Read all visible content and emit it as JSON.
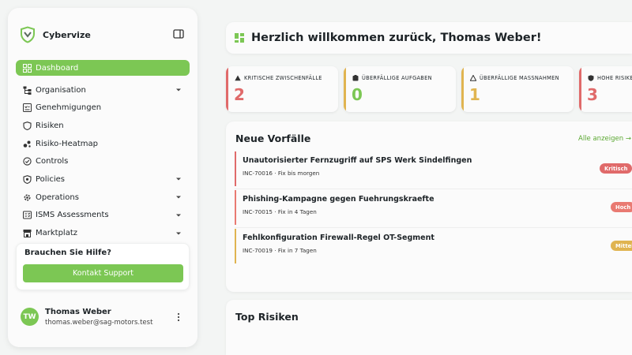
{
  "app": {
    "name": "Cybervize"
  },
  "sidebar": {
    "items": [
      {
        "label": "Dashboard",
        "icon": "grid-icon"
      },
      {
        "label": "Organisation",
        "icon": "org-icon"
      },
      {
        "label": "Genehmigungen",
        "icon": "approvals-icon"
      },
      {
        "label": "Risiken",
        "icon": "shield-icon"
      },
      {
        "label": "Risiko-Heatmap",
        "icon": "heatmap-icon"
      },
      {
        "label": "Controls",
        "icon": "controls-icon"
      },
      {
        "label": "Policies",
        "icon": "policy-icon"
      },
      {
        "label": "Operations",
        "icon": "gear-icon"
      },
      {
        "label": "ISMS Assessments",
        "icon": "assessment-icon"
      },
      {
        "label": "Marktplatz",
        "icon": "store-icon"
      }
    ],
    "help": {
      "title": "Brauchen Sie Hilfe?",
      "button": "Kontakt Support"
    },
    "user": {
      "initials": "TW",
      "name": "Thomas Weber",
      "email": "thomas.weber@sag-motors.test"
    }
  },
  "main": {
    "welcome": "Herzlich willkommen zurück, Thomas Weber!",
    "stats": [
      {
        "label": "KRITISCHE ZWISCHENFÄLLE",
        "value": "2",
        "color": "#e06a6a",
        "icon": "warning-icon"
      },
      {
        "label": "ÜBERFÄLLIGE AUFGABEN",
        "value": "0",
        "color": "#7cc754",
        "icon": "task-icon"
      },
      {
        "label": "ÜBERFÄLLIGE MASSNAHMEN",
        "value": "1",
        "color": "#e0b450",
        "icon": "warning-icon"
      },
      {
        "label": "HOHE RISIKEN",
        "value": "3",
        "color": "#e06a6a",
        "icon": "shield-icon"
      }
    ],
    "incidents": {
      "title": "Neue Vorfälle",
      "show_all": "Alle anzeigen →",
      "items": [
        {
          "title": "Unautorisierter Fernzugriff auf SPS Werk Sindelfingen",
          "sub": "INC-70016 · Fix bis morgen",
          "badge": "Kritisch",
          "color": "#e06a6a"
        },
        {
          "title": "Phishing-Kampagne gegen Fuehrungskraefte",
          "sub": "INC-70015 · Fix in 4 Tagen",
          "badge": "Hoch",
          "color": "#e97a72"
        },
        {
          "title": "Fehlkonfiguration Firewall-Regel OT-Segment",
          "sub": "INC-70019 · Fix in 7 Tagen",
          "badge": "Mittel",
          "color": "#e0b450"
        }
      ]
    },
    "risks": {
      "title": "Top Risiken"
    }
  },
  "colors": {
    "accent": "#7cc754",
    "critical": "#e06a6a",
    "medium": "#e0b450"
  }
}
